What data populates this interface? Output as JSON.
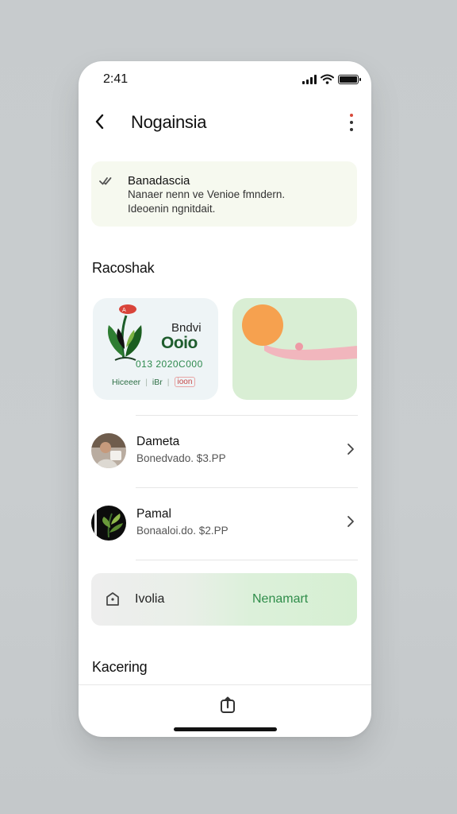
{
  "status_bar": {
    "time": "2:41"
  },
  "header": {
    "title": "Nogainsia",
    "back_icon": "chevron-left-icon",
    "more_icon": "more-vertical-icon"
  },
  "notice": {
    "title": "Banadascia",
    "lines": [
      "Nanaer nenn ve Venioe fmndern.",
      "Ideoenin ngnitdait."
    ]
  },
  "sections": {
    "recommended": "Racoshak",
    "bottom": "Kacering"
  },
  "cards": [
    {
      "brand_line1": "Bndvi",
      "brand_line2": "Ooio",
      "code": "013 2020C000",
      "meta": [
        "Hiceeer",
        "iBr",
        "ioon"
      ]
    },
    {
      "image": "abstract-orange-circle-pink-wave"
    }
  ],
  "list": [
    {
      "name": "Dameta",
      "subtitle": "Bonedvado. $3.PP"
    },
    {
      "name": "Pamal",
      "subtitle": "Bonaaloi.do. $2.PP"
    }
  ],
  "action_bar": {
    "label": "Ivolia",
    "cta": "Nenamart",
    "icon": "tag-icon"
  },
  "colors": {
    "accent_green": "#2f8d4a",
    "notice_bg": "#f6f9ef",
    "card_green": "#d9eed4"
  }
}
